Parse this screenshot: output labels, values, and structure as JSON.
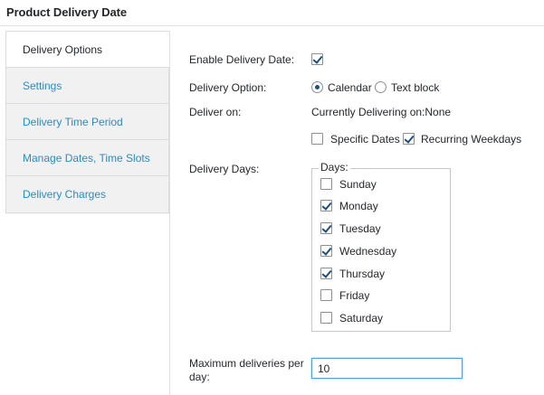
{
  "page": {
    "title": "Product Delivery Date"
  },
  "tabs": [
    {
      "label": "Delivery Options",
      "active": true
    },
    {
      "label": "Settings",
      "active": false
    },
    {
      "label": "Delivery Time Period",
      "active": false
    },
    {
      "label": "Manage Dates, Time Slots",
      "active": false
    },
    {
      "label": "Delivery Charges",
      "active": false
    }
  ],
  "form": {
    "enable_delivery_date": {
      "label": "Enable Delivery Date:",
      "checked": true
    },
    "delivery_option": {
      "label": "Delivery Option:",
      "options": [
        {
          "label": "Calendar",
          "selected": true
        },
        {
          "label": "Text block",
          "selected": false
        }
      ]
    },
    "deliver_on": {
      "label": "Deliver on:",
      "status": "Currently Delivering on:None",
      "specific_dates": {
        "label": "Specific Dates",
        "checked": false
      },
      "recurring_weekdays": {
        "label": "Recurring Weekdays",
        "checked": true
      }
    },
    "delivery_days": {
      "label": "Delivery Days:",
      "legend": "Days:",
      "days": [
        {
          "label": "Sunday",
          "checked": false
        },
        {
          "label": "Monday",
          "checked": true
        },
        {
          "label": "Tuesday",
          "checked": true
        },
        {
          "label": "Wednesday",
          "checked": true
        },
        {
          "label": "Thursday",
          "checked": true
        },
        {
          "label": "Friday",
          "checked": false
        },
        {
          "label": "Saturday",
          "checked": false
        }
      ]
    },
    "max_deliveries": {
      "label": "Maximum deliveries per day:",
      "value": "10"
    }
  }
}
